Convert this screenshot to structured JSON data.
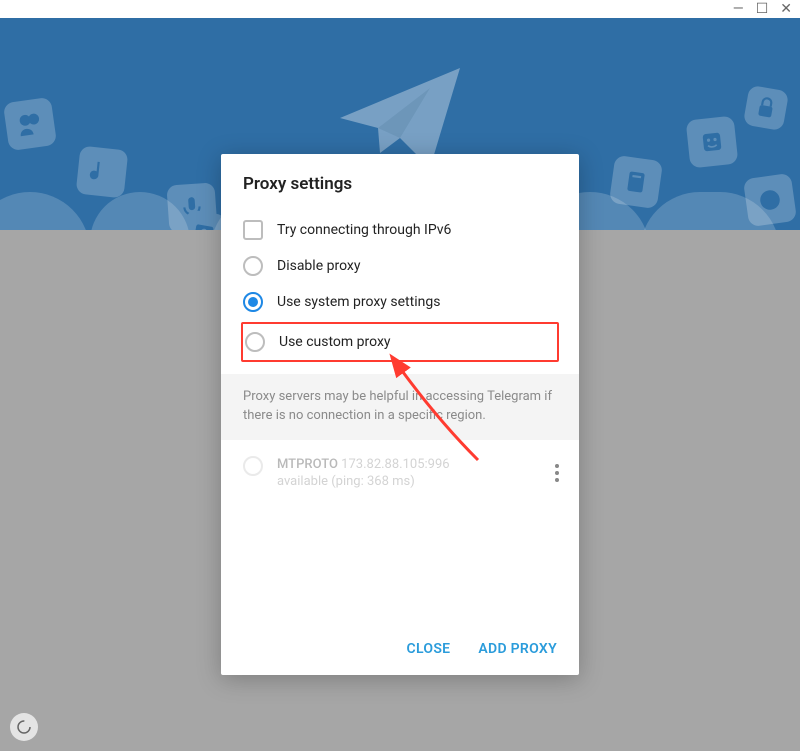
{
  "window": {
    "minimize_glyph": "—",
    "maximize_glyph": "☐",
    "close_glyph": "✕"
  },
  "modal": {
    "title": "Proxy settings",
    "options": {
      "ipv6": "Try connecting through IPv6",
      "disable": "Disable proxy",
      "system": "Use system proxy settings",
      "custom": "Use custom proxy"
    },
    "info": "Proxy servers may be helpful in accessing Telegram if there is no connection in a specific region.",
    "proxy_entry": {
      "name": "MTPROTO",
      "address": "173.82.88.105:996",
      "status": "available (ping: 368 ms)"
    },
    "actions": {
      "close": "CLOSE",
      "add": "ADD PROXY"
    },
    "selected": "system"
  }
}
